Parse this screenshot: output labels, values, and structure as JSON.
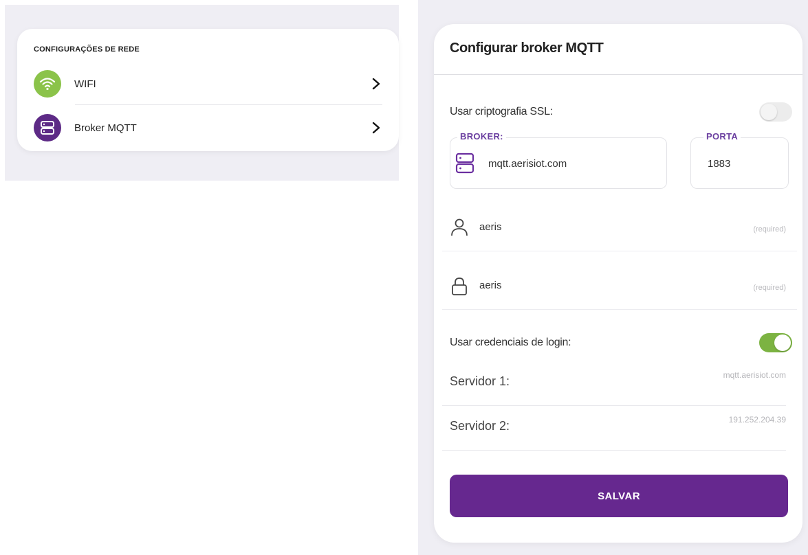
{
  "network": {
    "title": "CONFIGURAÇÕES DE REDE",
    "items": [
      {
        "label": "WIFI",
        "icon": "wifi-icon",
        "color": "#8bc34a"
      },
      {
        "label": "Broker MQTT",
        "icon": "server-icon",
        "color": "#5d2a86"
      }
    ]
  },
  "mqtt": {
    "title": "Configurar broker MQTT",
    "ssl_label": "Usar criptografia SSL:",
    "ssl_enabled": false,
    "broker_legend": "BROKER:",
    "broker_value": "mqtt.aerisiot.com",
    "port_legend": "PORTA",
    "port_value": "1883",
    "username_value": "aeris",
    "password_value": "aeris",
    "required_hint": "(required)",
    "credentials_label": "Usar credenciais de login:",
    "credentials_enabled": true,
    "server1_label": "Servidor 1:",
    "server1_value": "mqtt.aerisiot.com",
    "server2_label": "Servidor 2:",
    "server2_value": "191.252.204.39",
    "save_label": "SALVAR"
  },
  "colors": {
    "accent": "#66288f",
    "toggle_on": "#7cb342",
    "wifi": "#8bc34a"
  }
}
